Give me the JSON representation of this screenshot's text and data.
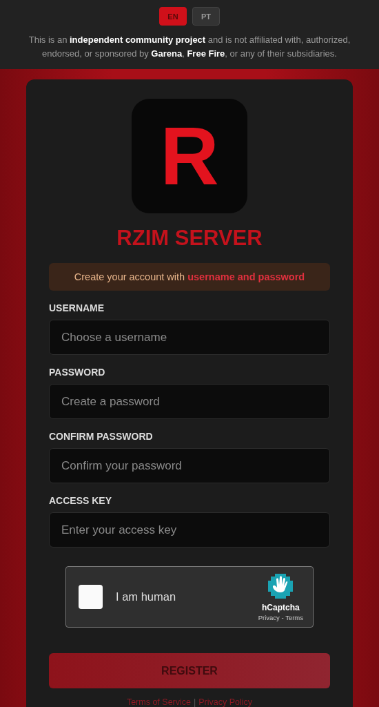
{
  "languages": [
    {
      "label": "EN",
      "selected": true
    },
    {
      "label": "PT",
      "selected": false
    }
  ],
  "disclaimer": "This is an **independent community project** and is not affiliated with, authorized, endorsed, or sponsored by **Garena**, **Free Fire**, or any of their subsidiaries.",
  "logo_letter": "R",
  "title": "RZIM SERVER",
  "notice": "Create your account with **username and password**",
  "fields": [
    {
      "label": "USERNAME",
      "placeholder": "Choose a username"
    },
    {
      "label": "PASSWORD",
      "placeholder": "Create a password"
    },
    {
      "label": "CONFIRM PASSWORD",
      "placeholder": "Confirm your password"
    },
    {
      "label": "ACCESS KEY",
      "placeholder": "Enter your access key"
    }
  ],
  "captcha": {
    "label": "I am human",
    "checked": false,
    "brand": "hCaptcha",
    "links": "Privacy - Terms"
  },
  "register_button": "REGISTER",
  "footer_links": [
    "Terms of Service",
    "Privacy Policy"
  ],
  "footer_separator": "|"
}
